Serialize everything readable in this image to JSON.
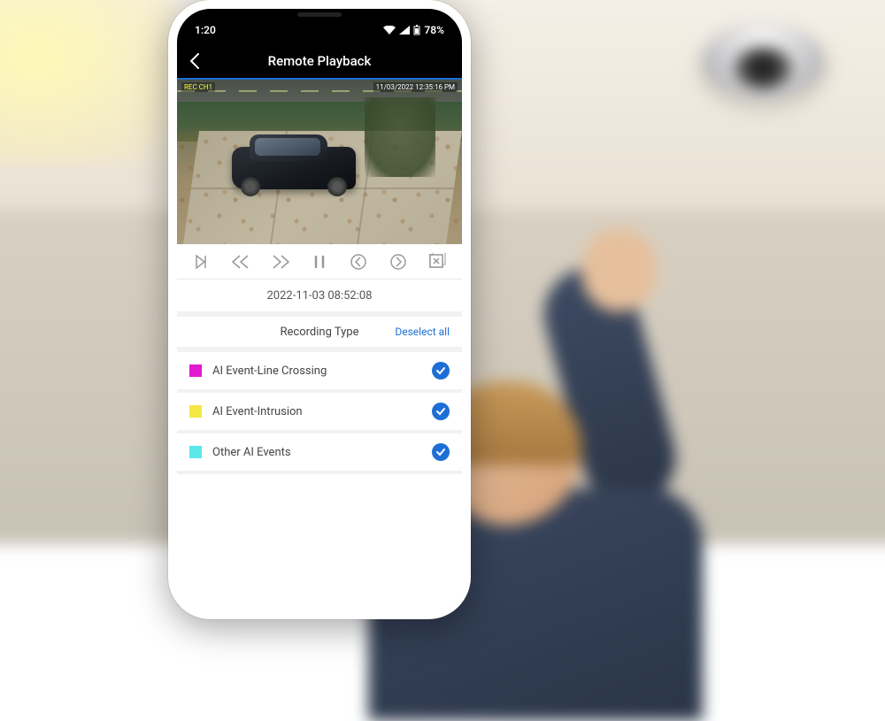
{
  "status_bar": {
    "time": "1:20",
    "battery": "78%"
  },
  "app_header": {
    "title": "Remote Playback"
  },
  "video": {
    "overlay_timestamp": "11/03/2022 12:35:16 PM",
    "overlay_rec": "REC CH1"
  },
  "playback": {
    "timestamp": "2022-11-03 08:52:08"
  },
  "recording_type": {
    "title": "Recording Type",
    "deselect_label": "Deselect all",
    "events": [
      {
        "color": "#e01bd0",
        "label": "AI Event-Line Crossing",
        "checked": true
      },
      {
        "color": "#f4e842",
        "label": "AI Event-Intrusion",
        "checked": true
      },
      {
        "color": "#5ae8e8",
        "label": "Other AI Events",
        "checked": true
      }
    ]
  },
  "colors": {
    "accent": "#1d6fd6"
  }
}
